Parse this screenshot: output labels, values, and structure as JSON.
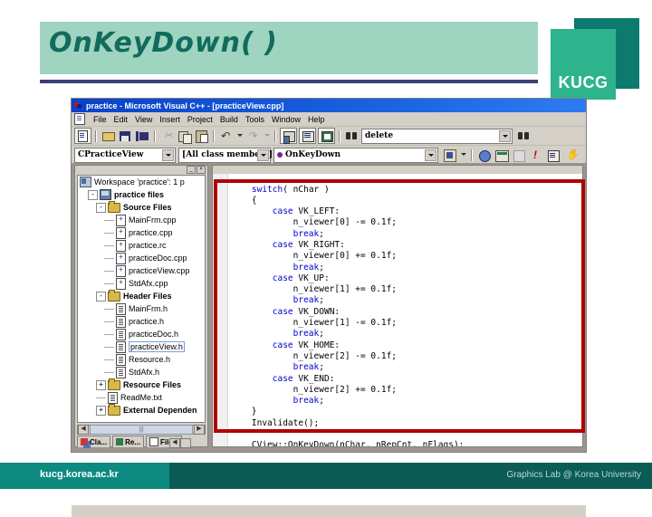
{
  "slide": {
    "title": "OnKeyDown( )",
    "logo_text": "KUCG",
    "footer_url": "kucg.korea.ac.kr",
    "footer_credit": "Graphics Lab @ Korea University",
    "colors": {
      "banner": "#9ed4c0",
      "title_text": "#126b5c",
      "rule": "#3b3f7a",
      "logo_front": "#2eb48c",
      "logo_back": "#0c7a6e",
      "footer_left": "#0c8a80",
      "footer_right": "#0a5c54",
      "annotation_red": "#b00000"
    }
  },
  "vc": {
    "title": "practice - Microsoft Visual C++ - [practiceView.cpp]",
    "menu": [
      {
        "label": "File"
      },
      {
        "label": "Edit"
      },
      {
        "label": "View"
      },
      {
        "label": "Insert"
      },
      {
        "label": "Project"
      },
      {
        "label": "Build"
      },
      {
        "label": "Tools"
      },
      {
        "label": "Window"
      },
      {
        "label": "Help"
      }
    ],
    "toolbar_icons": [
      "new-file-icon",
      "open-file-icon",
      "save-icon",
      "save-all-icon",
      "cut-icon",
      "copy-icon",
      "paste-icon",
      "undo-icon",
      "redo-icon",
      "workspace-icon",
      "output-window-icon",
      "window-list-icon"
    ],
    "find_box": {
      "value": "delete",
      "icon": "find-icon"
    },
    "find_next_icon": "find-next-icon",
    "wizard_bar": {
      "class_combo": "CPracticeView",
      "members_combo": "[All class members]",
      "function_combo": "OnKeyDown",
      "action_icon": "wizardbar-actions-icon",
      "build_icons": [
        "compile-icon",
        "build-icon",
        "stop-build-icon",
        "insert-breakpoint-icon",
        "go-icon",
        "hand-icon"
      ]
    },
    "tree": {
      "rows": [
        {
          "indent": 0,
          "expander": "",
          "icon": "workspace-icon",
          "label": "Workspace 'practice': 1 p",
          "bold": false,
          "selected": false
        },
        {
          "indent": 1,
          "expander": "-",
          "icon": "project-icon",
          "label": "practice files",
          "bold": true,
          "selected": false
        },
        {
          "indent": 2,
          "expander": "-",
          "icon": "folder-icon",
          "label": "Source Files",
          "bold": true,
          "selected": false
        },
        {
          "indent": 3,
          "expander": "",
          "icon": "cpp-file-icon",
          "label": "MainFrm.cpp",
          "bold": false,
          "selected": false
        },
        {
          "indent": 3,
          "expander": "",
          "icon": "cpp-file-icon",
          "label": "practice.cpp",
          "bold": false,
          "selected": false
        },
        {
          "indent": 3,
          "expander": "",
          "icon": "cpp-file-icon",
          "label": "practice.rc",
          "bold": false,
          "selected": false
        },
        {
          "indent": 3,
          "expander": "",
          "icon": "cpp-file-icon",
          "label": "practiceDoc.cpp",
          "bold": false,
          "selected": false
        },
        {
          "indent": 3,
          "expander": "",
          "icon": "cpp-file-icon",
          "label": "practiceView.cpp",
          "bold": false,
          "selected": false
        },
        {
          "indent": 3,
          "expander": "",
          "icon": "cpp-file-icon",
          "label": "StdAfx.cpp",
          "bold": false,
          "selected": false
        },
        {
          "indent": 2,
          "expander": "-",
          "icon": "folder-icon",
          "label": "Header Files",
          "bold": true,
          "selected": false
        },
        {
          "indent": 3,
          "expander": "",
          "icon": "header-file-icon",
          "label": "MainFrm.h",
          "bold": false,
          "selected": false
        },
        {
          "indent": 3,
          "expander": "",
          "icon": "header-file-icon",
          "label": "practice.h",
          "bold": false,
          "selected": false
        },
        {
          "indent": 3,
          "expander": "",
          "icon": "header-file-icon",
          "label": "practiceDoc.h",
          "bold": false,
          "selected": false
        },
        {
          "indent": 3,
          "expander": "",
          "icon": "header-file-icon",
          "label": "practiceView.h",
          "bold": false,
          "selected": true
        },
        {
          "indent": 3,
          "expander": "",
          "icon": "header-file-icon",
          "label": "Resource.h",
          "bold": false,
          "selected": false
        },
        {
          "indent": 3,
          "expander": "",
          "icon": "header-file-icon",
          "label": "StdAfx.h",
          "bold": false,
          "selected": false
        },
        {
          "indent": 2,
          "expander": "+",
          "icon": "folder-icon",
          "label": "Resource Files",
          "bold": true,
          "selected": false
        },
        {
          "indent": 2,
          "expander": "",
          "icon": "header-file-icon",
          "label": "ReadMe.txt",
          "bold": false,
          "selected": false
        },
        {
          "indent": 2,
          "expander": "+",
          "icon": "folder-icon",
          "label": "External Dependen",
          "bold": true,
          "selected": false
        }
      ],
      "tabs": [
        {
          "label": "Cla...",
          "icon": "classview-icon"
        },
        {
          "label": "Re...",
          "icon": "resourceview-icon"
        },
        {
          "label": "File...",
          "icon": "fileview-icon"
        }
      ]
    },
    "editor": {
      "code_lines": [
        {
          "indent": 4,
          "tokens": [
            {
              "t": "switch",
              "k": true
            },
            {
              "t": "( nChar )",
              "k": false
            }
          ]
        },
        {
          "indent": 4,
          "tokens": [
            {
              "t": "{",
              "k": false
            }
          ]
        },
        {
          "indent": 8,
          "tokens": [
            {
              "t": "case",
              "k": true
            },
            {
              "t": " VK_LEFT:",
              "k": false
            }
          ]
        },
        {
          "indent": 12,
          "tokens": [
            {
              "t": "n_viewer[0] -= 0.1f;",
              "k": false
            }
          ]
        },
        {
          "indent": 12,
          "tokens": [
            {
              "t": "break",
              "k": true
            },
            {
              "t": ";",
              "k": false
            }
          ]
        },
        {
          "indent": 8,
          "tokens": [
            {
              "t": "case",
              "k": true
            },
            {
              "t": " VK_RIGHT:",
              "k": false
            }
          ]
        },
        {
          "indent": 12,
          "tokens": [
            {
              "t": "n_viewer[0] += 0.1f;",
              "k": false
            }
          ]
        },
        {
          "indent": 12,
          "tokens": [
            {
              "t": "break",
              "k": true
            },
            {
              "t": ";",
              "k": false
            }
          ]
        },
        {
          "indent": 8,
          "tokens": [
            {
              "t": "case",
              "k": true
            },
            {
              "t": " VK_UP:",
              "k": false
            }
          ]
        },
        {
          "indent": 12,
          "tokens": [
            {
              "t": "n_viewer[1] += 0.1f;",
              "k": false
            }
          ]
        },
        {
          "indent": 12,
          "tokens": [
            {
              "t": "break",
              "k": true
            },
            {
              "t": ";",
              "k": false
            }
          ]
        },
        {
          "indent": 8,
          "tokens": [
            {
              "t": "case",
              "k": true
            },
            {
              "t": " VK_DOWN:",
              "k": false
            }
          ]
        },
        {
          "indent": 12,
          "tokens": [
            {
              "t": "n_viewer[1] -= 0.1f;",
              "k": false
            }
          ]
        },
        {
          "indent": 12,
          "tokens": [
            {
              "t": "break",
              "k": true
            },
            {
              "t": ";",
              "k": false
            }
          ]
        },
        {
          "indent": 8,
          "tokens": [
            {
              "t": "case",
              "k": true
            },
            {
              "t": " VK_HOME:",
              "k": false
            }
          ]
        },
        {
          "indent": 12,
          "tokens": [
            {
              "t": "n_viewer[2] -= 0.1f;",
              "k": false
            }
          ]
        },
        {
          "indent": 12,
          "tokens": [
            {
              "t": "break",
              "k": true
            },
            {
              "t": ";",
              "k": false
            }
          ]
        },
        {
          "indent": 8,
          "tokens": [
            {
              "t": "case",
              "k": true
            },
            {
              "t": " VK_END:",
              "k": false
            }
          ]
        },
        {
          "indent": 12,
          "tokens": [
            {
              "t": "n_viewer[2] += 0.1f;",
              "k": false
            }
          ]
        },
        {
          "indent": 12,
          "tokens": [
            {
              "t": "break",
              "k": true
            },
            {
              "t": ";",
              "k": false
            }
          ]
        },
        {
          "indent": 4,
          "tokens": [
            {
              "t": "}",
              "k": false
            }
          ]
        },
        {
          "indent": 4,
          "tokens": [
            {
              "t": "Invalidate();",
              "k": false
            }
          ]
        },
        {
          "indent": 4,
          "tokens": [
            {
              "t": "",
              "k": false
            }
          ]
        },
        {
          "indent": 4,
          "tokens": [
            {
              "t": "CView::OnKeyDown(nChar, nRepCnt, nFlags);",
              "k": false
            }
          ]
        }
      ]
    }
  }
}
